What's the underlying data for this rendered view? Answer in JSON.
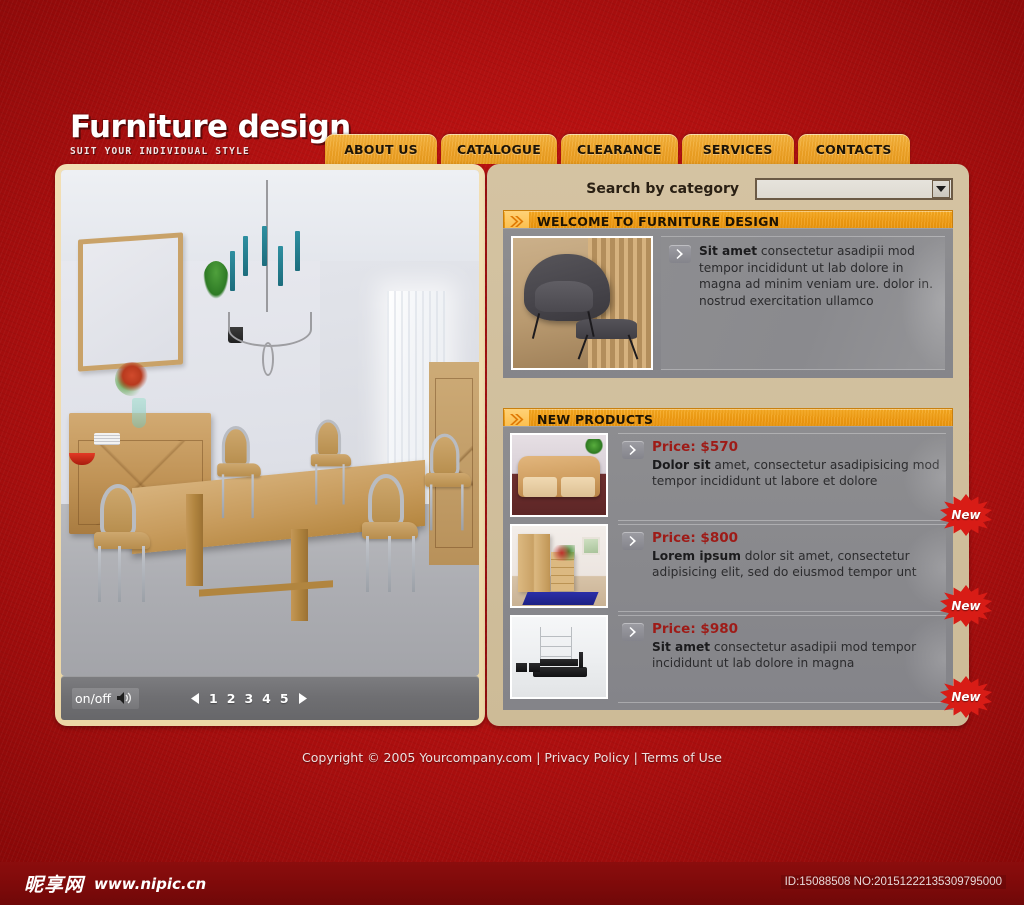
{
  "brand": {
    "title": "Furniture design",
    "tagline": "SUIT YOUR INDIVIDUAL STYLE"
  },
  "nav": {
    "items": [
      {
        "label": "ABOUT US"
      },
      {
        "label": "CATALOGUE"
      },
      {
        "label": "CLEARANCE"
      },
      {
        "label": "SERVICES"
      },
      {
        "label": "CONTACTS"
      }
    ]
  },
  "search": {
    "label": "Search by category",
    "value": "",
    "placeholder": "",
    "icon": "chevron-down-icon"
  },
  "hero": {
    "alt": "dining-room-interior",
    "controls": {
      "onoff_label": "on/off",
      "sound_icon": "speaker-icon",
      "prev_icon": "triangle-left-icon",
      "next_icon": "triangle-right-icon",
      "pages": [
        "1",
        "2",
        "3",
        "4",
        "5"
      ]
    }
  },
  "welcome": {
    "section_title": "WELCOME TO FURNITURE DESIGN",
    "section_icon": "double-chevron-right-icon",
    "thumb_alt": "womb-chair-and-ottoman",
    "bullet_icon": "chevron-right-icon",
    "lead": "Sit amet",
    "text": " consectetur asadipii mod tempor incididunt ut lab dolore in magna ad minim veniam ure. dolor in.",
    "text2": "nostrud exercitation ullamco"
  },
  "products": {
    "section_title": "NEW PRODUCTS",
    "section_icon": "double-chevron-right-icon",
    "badge_label": "New",
    "bullet_icon": "chevron-right-icon",
    "items": [
      {
        "price": "Price: $570",
        "lead": "Dolor sit",
        "text": " amet, consectetur asadipisicing mod tempor incididunt ut labore et dolore",
        "thumb_alt": "leather-sofa",
        "badge": "New"
      },
      {
        "price": "Price: $800",
        "lead": "Lorem ipsum",
        "text": " dolor sit amet, consectetur adipisicing elit, sed do eiusmod tempor unt",
        "thumb_alt": "wardrobe-and-dresser",
        "badge": "New"
      },
      {
        "price": "Price: $980",
        "lead": "Sit amet",
        "text": " consectetur asadipii  mod tempor incididunt ut lab  dolore in magna",
        "thumb_alt": "modern-white-loft",
        "badge": "New"
      }
    ]
  },
  "footer": {
    "copyright": "Copyright © 2005 Yourcompany.com",
    "sep1": "|",
    "privacy": "Privacy Policy",
    "sep2": "|",
    "terms": "Terms of Use"
  },
  "watermark": {
    "logo": "昵享网",
    "url": "www.nipic.cn",
    "id": "ID:15088508 NO:20151222135309795000"
  },
  "colors": {
    "page_red": "#b81111",
    "tab_orange": "#f0a62a",
    "panel_tan": "#ecd7a6",
    "panel_khaki": "#cdbb97",
    "section_orange": "#f09c12",
    "price_red": "#9e1b17",
    "card_grey": "#8d8d90",
    "badge_red": "#d81c16"
  }
}
